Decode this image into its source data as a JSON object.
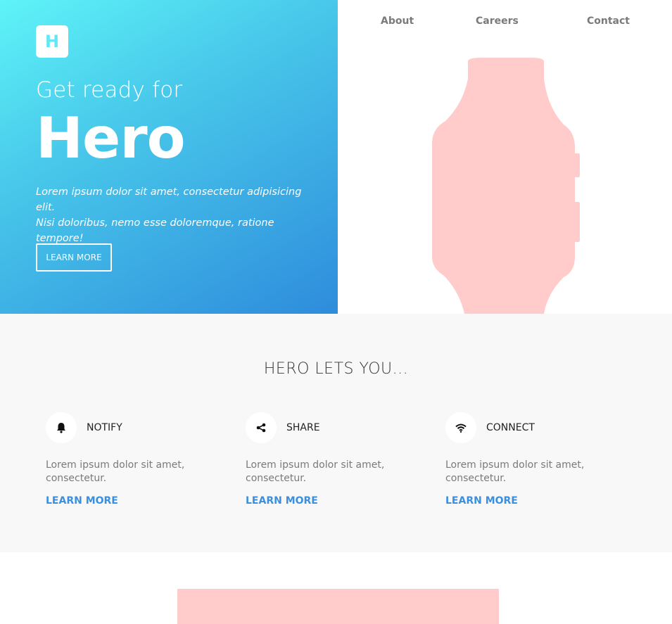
{
  "hero": {
    "logo_letter": "H",
    "subtitle": "Get ready for",
    "title": "Hero",
    "description_line1": "Lorem ipsum dolor sit amet, consectetur adipisicing elit.",
    "description_line2": "Nisi doloribus, nemo esse doloremque, ratione tempore!",
    "button_label": "LEARN MORE"
  },
  "nav": {
    "items": [
      {
        "label": "About"
      },
      {
        "label": "Careers"
      },
      {
        "label": "Contact"
      }
    ]
  },
  "features": {
    "heading": "HERO LETS YOU...",
    "items": [
      {
        "icon": "bell-icon",
        "title": "NOTIFY",
        "text": "Lorem ipsum dolor sit amet, consectetur.",
        "link": "LEARN MORE"
      },
      {
        "icon": "share-icon",
        "title": "SHARE",
        "text": "Lorem ipsum dolor sit amet, consectetur.",
        "link": "LEARN MORE"
      },
      {
        "icon": "wifi-icon",
        "title": "CONNECT",
        "text": "Lorem ipsum dolor sit amet, consectetur.",
        "link": "LEARN MORE"
      }
    ]
  },
  "colors": {
    "gradient_start": "#5ef4f8",
    "gradient_end": "#2e8cdc",
    "accent_link": "#3a8fde",
    "watch_fill": "#ffcccb",
    "features_bg": "#f8f8f8"
  }
}
